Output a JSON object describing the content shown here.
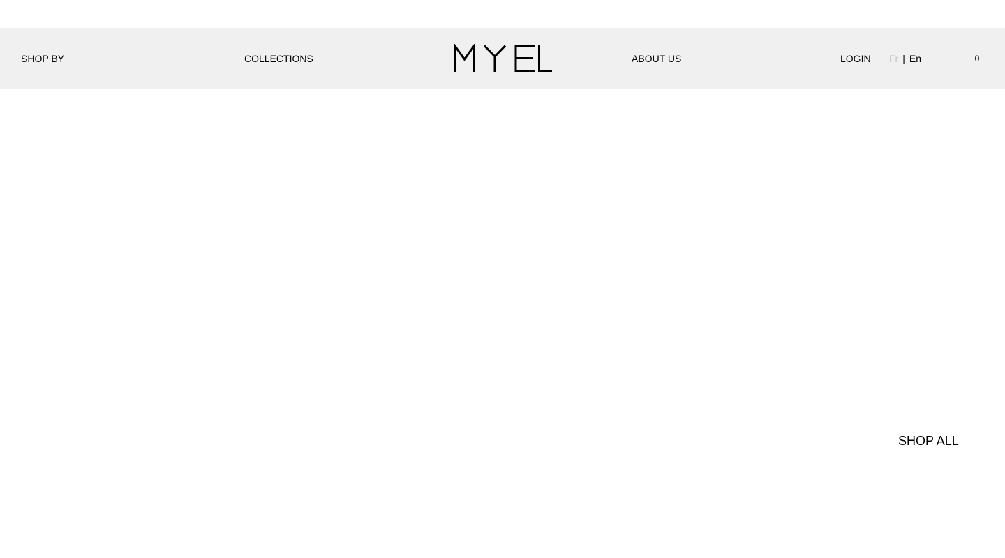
{
  "header": {
    "shop_by": "SHOP BY",
    "collections": "COLLECTIONS",
    "logo_text": "MYEL",
    "about_us": "ABOUT US",
    "login": "LOGIN",
    "language": {
      "fr": "Fr",
      "separator": "|",
      "en": "En",
      "active": "En"
    },
    "cart_count": "0",
    "background_color": "#f0f0f0"
  },
  "hero": {
    "shop_all": "SHOP ALL"
  }
}
